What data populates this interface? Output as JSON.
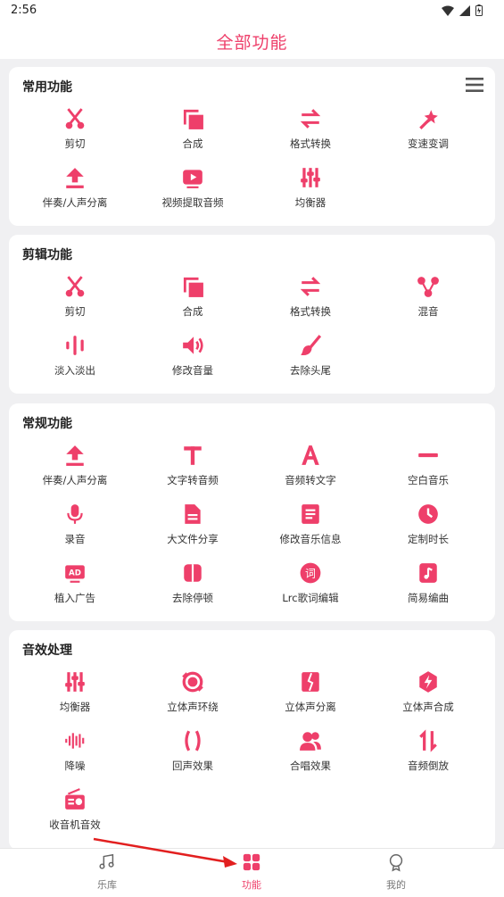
{
  "status": {
    "time": "2:56"
  },
  "header": {
    "title": "全部功能"
  },
  "sections": [
    {
      "title": "常用功能",
      "items": [
        {
          "label": "剪切",
          "icon": "scissors-icon"
        },
        {
          "label": "合成",
          "icon": "merge-icon"
        },
        {
          "label": "格式转换",
          "icon": "swap-arrows-icon"
        },
        {
          "label": "变速变调",
          "icon": "magic-wand-icon"
        },
        {
          "label": "伴奏/人声分离",
          "icon": "upload-arrow-icon"
        },
        {
          "label": "视频提取音频",
          "icon": "video-play-icon"
        },
        {
          "label": "均衡器",
          "icon": "equalizer-icon"
        }
      ]
    },
    {
      "title": "剪辑功能",
      "items": [
        {
          "label": "剪切",
          "icon": "scissors-icon"
        },
        {
          "label": "合成",
          "icon": "merge-icon"
        },
        {
          "label": "格式转换",
          "icon": "swap-arrows-icon"
        },
        {
          "label": "混音",
          "icon": "mix-nodes-icon"
        },
        {
          "label": "淡入淡出",
          "icon": "waveform-bars-icon"
        },
        {
          "label": "修改音量",
          "icon": "volume-icon"
        },
        {
          "label": "去除头尾",
          "icon": "brush-icon"
        }
      ]
    },
    {
      "title": "常规功能",
      "items": [
        {
          "label": "伴奏/人声分离",
          "icon": "upload-arrow-icon"
        },
        {
          "label": "文字转音频",
          "icon": "text-t-icon"
        },
        {
          "label": "音频转文字",
          "icon": "text-a-icon"
        },
        {
          "label": "空白音乐",
          "icon": "minus-icon"
        },
        {
          "label": "录音",
          "icon": "microphone-icon"
        },
        {
          "label": "大文件分享",
          "icon": "document-icon"
        },
        {
          "label": "修改音乐信息",
          "icon": "info-list-icon"
        },
        {
          "label": "定制时长",
          "icon": "clock-icon"
        },
        {
          "label": "植入广告",
          "icon": "ad-badge-icon"
        },
        {
          "label": "去除停顿",
          "icon": "pause-icon"
        },
        {
          "label": "Lrc歌词编辑",
          "icon": "lyrics-icon"
        },
        {
          "label": "简易编曲",
          "icon": "music-sheet-icon"
        }
      ]
    },
    {
      "title": "音效处理",
      "items": [
        {
          "label": "均衡器",
          "icon": "equalizer-icon"
        },
        {
          "label": "立体声环绕",
          "icon": "surround-icon"
        },
        {
          "label": "立体声分离",
          "icon": "split-icon"
        },
        {
          "label": "立体声合成",
          "icon": "bolt-hexagon-icon"
        },
        {
          "label": "降噪",
          "icon": "noise-wave-icon"
        },
        {
          "label": "回声效果",
          "icon": "parentheses-icon"
        },
        {
          "label": "合唱效果",
          "icon": "people-icon"
        },
        {
          "label": "音频倒放",
          "icon": "reverse-arrows-icon"
        },
        {
          "label": "收音机音效",
          "icon": "radio-icon"
        }
      ]
    }
  ],
  "tabs": [
    {
      "label": "乐库",
      "icon": "music-note-icon",
      "active": false
    },
    {
      "label": "功能",
      "icon": "grid-icon",
      "active": true
    },
    {
      "label": "我的",
      "icon": "profile-icon",
      "active": false
    }
  ],
  "colors": {
    "accent": "#ee3f6a",
    "background": "#f0f0f2"
  }
}
